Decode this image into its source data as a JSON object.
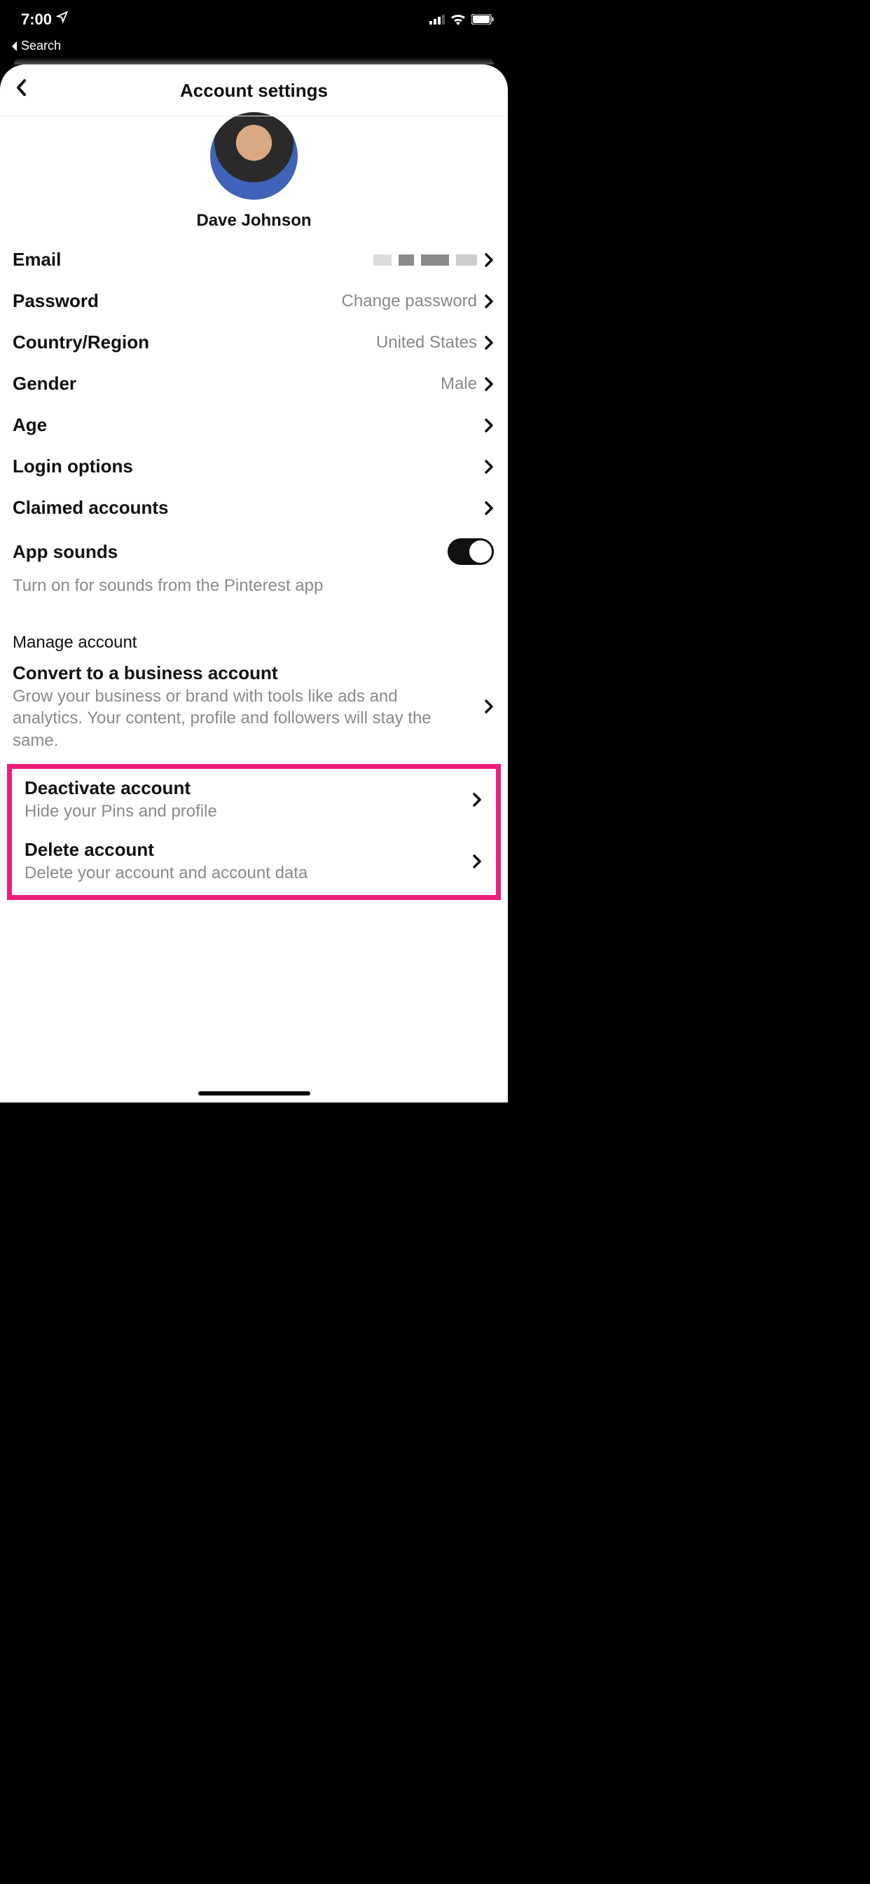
{
  "status": {
    "time": "7:00",
    "back_breadcrumb": "Search"
  },
  "header": {
    "title": "Account settings"
  },
  "profile": {
    "name": "Dave Johnson"
  },
  "rows": {
    "email": {
      "label": "Email"
    },
    "password": {
      "label": "Password",
      "value": "Change password"
    },
    "country": {
      "label": "Country/Region",
      "value": "United States"
    },
    "gender": {
      "label": "Gender",
      "value": "Male"
    },
    "age": {
      "label": "Age"
    },
    "login": {
      "label": "Login options"
    },
    "claimed": {
      "label": "Claimed accounts"
    },
    "sounds": {
      "label": "App sounds",
      "sub": "Turn on for sounds from the Pinterest app"
    }
  },
  "manage": {
    "title": "Manage account",
    "convert": {
      "title": "Convert to a business account",
      "sub": "Grow your business or brand with tools like ads and analytics. Your content, profile and followers will stay the same."
    },
    "deactivate": {
      "title": "Deactivate account",
      "sub": "Hide your Pins and profile"
    },
    "delete": {
      "title": "Delete account",
      "sub": "Delete your account and account data"
    }
  }
}
